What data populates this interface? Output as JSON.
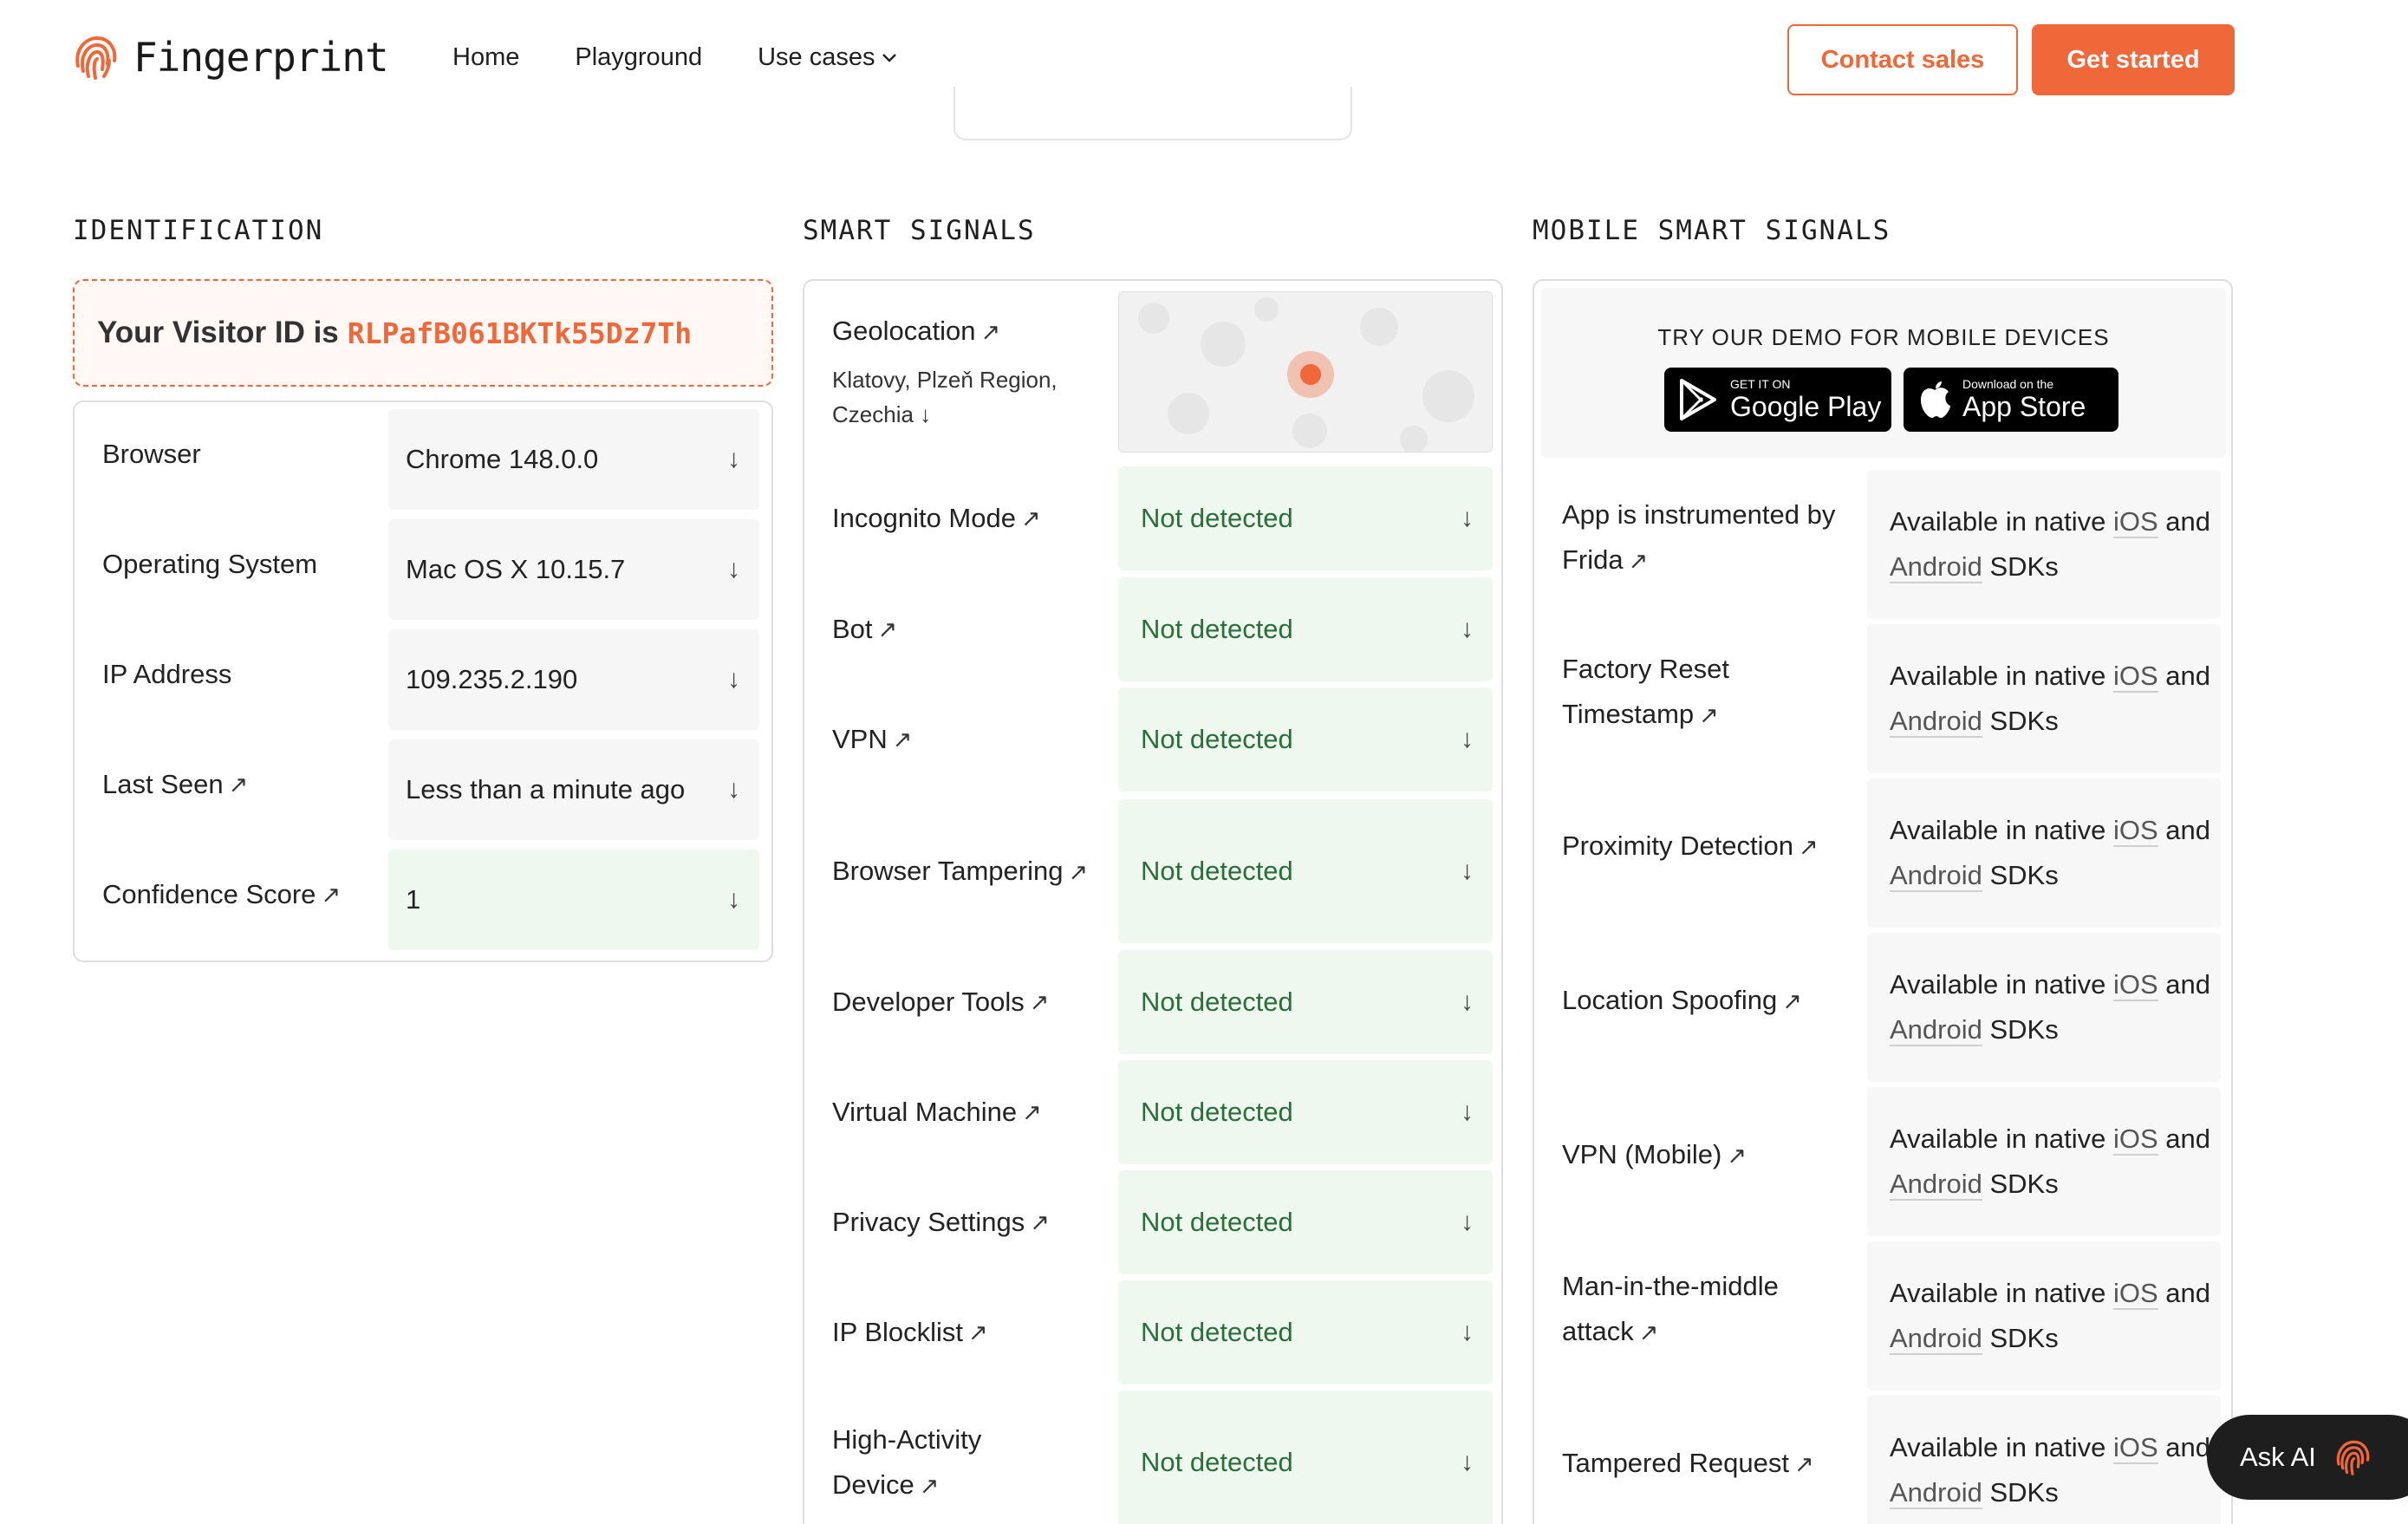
{
  "header": {
    "brand": "Fingerprint",
    "nav": [
      {
        "label": "Home"
      },
      {
        "label": "Playground"
      },
      {
        "label": "Use cases"
      }
    ],
    "contact_sales": "Contact sales",
    "get_started": "Get started",
    "accent_color": "#f0673a"
  },
  "identification": {
    "title": "IDENTIFICATION",
    "visitor_prefix": "Your Visitor ID is",
    "visitor_id": "RLPafB061BKTk55Dz7Th",
    "rows": [
      {
        "label": "Browser",
        "value": "Chrome 148.0.0",
        "external": false
      },
      {
        "label": "Operating System",
        "value": "Mac OS X 10.15.7",
        "external": false
      },
      {
        "label": "IP Address",
        "value": "109.235.2.190",
        "external": false
      },
      {
        "label": "Last Seen",
        "value": "Less than a minute ago",
        "external": true
      },
      {
        "label": "Confidence Score",
        "value": "1",
        "external": true
      }
    ]
  },
  "smart_signals": {
    "title": "SMART SIGNALS",
    "geolocation": {
      "label": "Geolocation",
      "location": "Klatovy, Plzeň Region, Czechia"
    },
    "rows": [
      {
        "label": "Incognito Mode",
        "value": "Not detected"
      },
      {
        "label": "Bot",
        "value": "Not detected"
      },
      {
        "label": "VPN",
        "value": "Not detected"
      },
      {
        "label": "Browser Tampering",
        "value": "Not detected"
      },
      {
        "label": "Developer Tools",
        "value": "Not detected"
      },
      {
        "label": "Virtual Machine",
        "value": "Not detected"
      },
      {
        "label": "Privacy Settings",
        "value": "Not detected"
      },
      {
        "label": "IP Blocklist",
        "value": "Not detected"
      },
      {
        "label": "High-Activity Device",
        "value": "Not detected"
      }
    ]
  },
  "mobile_smart_signals": {
    "title": "MOBILE SMART SIGNALS",
    "demo_title": "TRY OUR DEMO FOR MOBILE DEVICES",
    "google_play": {
      "small": "GET IT ON",
      "big": "Google Play"
    },
    "app_store": {
      "small": "Download on the",
      "big": "App Store"
    },
    "availability": {
      "pre": "Available in native",
      "ios": "iOS",
      "mid": "and",
      "android": "Android",
      "post": "SDKs"
    },
    "rows": [
      {
        "label": "App is instrumented by Frida"
      },
      {
        "label": "Factory Reset Timestamp"
      },
      {
        "label": "Proximity Detection"
      },
      {
        "label": "Location Spoofing"
      },
      {
        "label": "VPN (Mobile)"
      },
      {
        "label": "Man-in-the-middle attack"
      },
      {
        "label": "Tampered Request"
      }
    ]
  },
  "ask_ai": "Ask AI"
}
